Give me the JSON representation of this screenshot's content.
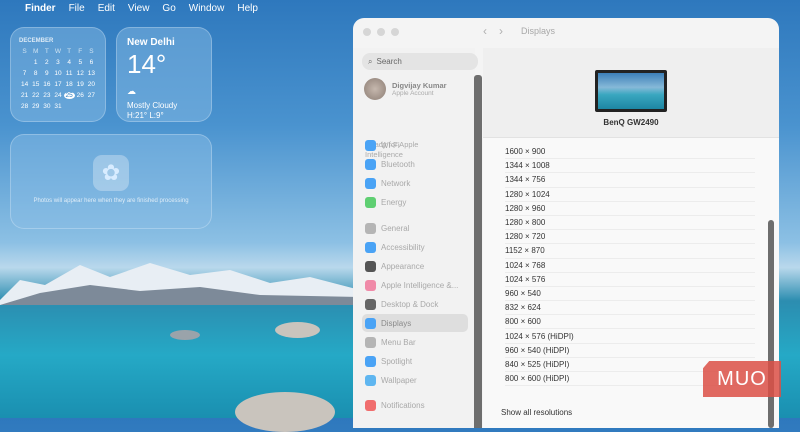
{
  "menubar": {
    "items": [
      "Finder",
      "File",
      "Edit",
      "View",
      "Go",
      "Window",
      "Help"
    ]
  },
  "calendar": {
    "month": "DECEMBER",
    "days_of_week": [
      "S",
      "M",
      "T",
      "W",
      "T",
      "F",
      "S"
    ],
    "days": [
      "",
      "1",
      "2",
      "3",
      "4",
      "5",
      "6",
      "7",
      "8",
      "9",
      "10",
      "11",
      "12",
      "13",
      "14",
      "15",
      "16",
      "17",
      "18",
      "19",
      "20",
      "21",
      "22",
      "23",
      "24",
      "25",
      "26",
      "27",
      "28",
      "29",
      "30",
      "31",
      "",
      "",
      ""
    ],
    "today": "25"
  },
  "weather": {
    "city": "New Delhi",
    "temp": "14°",
    "condition": "Mostly Cloudy",
    "hilo": "H:21° L:9°"
  },
  "photos": {
    "message": "Photos will appear here when they are finished processing"
  },
  "window": {
    "title": "Displays",
    "search_placeholder": "Search",
    "account": {
      "name": "Digvijay Kumar",
      "sub": "Apple Account"
    },
    "ready": "Ready for Apple Intelligence",
    "sidebar": [
      {
        "label": "Wi-Fi",
        "icon": "wifi-icon",
        "color": "#4aa3f5"
      },
      {
        "label": "Bluetooth",
        "icon": "bluetooth-icon",
        "color": "#4aa3f5"
      },
      {
        "label": "Network",
        "icon": "globe-icon",
        "color": "#4aa3f5"
      },
      {
        "label": "Energy",
        "icon": "battery-icon",
        "color": "#5fcf72"
      },
      {
        "label": "General",
        "icon": "gear-icon",
        "color": "#b5b5b5"
      },
      {
        "label": "Accessibility",
        "icon": "accessibility-icon",
        "color": "#4aa3f5"
      },
      {
        "label": "Appearance",
        "icon": "appearance-icon",
        "color": "#555555"
      },
      {
        "label": "Apple Intelligence &...",
        "icon": "apple-intelligence-icon",
        "color": "#f08aa8"
      },
      {
        "label": "Desktop & Dock",
        "icon": "dock-icon",
        "color": "#666666"
      },
      {
        "label": "Displays",
        "icon": "sun-icon",
        "color": "#4aa3f5"
      },
      {
        "label": "Menu Bar",
        "icon": "menubar-icon",
        "color": "#b5b5b5"
      },
      {
        "label": "Spotlight",
        "icon": "spotlight-icon",
        "color": "#4aa3f5"
      },
      {
        "label": "Wallpaper",
        "icon": "wallpaper-icon",
        "color": "#5fb6f0"
      },
      {
        "label": "Notifications",
        "icon": "bell-icon",
        "color": "#f06d6d"
      }
    ],
    "display_name": "BenQ GW2490",
    "resolutions": [
      "1600 × 900",
      "1344 × 1008",
      "1344 × 756",
      "1280 × 1024",
      "1280 × 960",
      "1280 × 800",
      "1280 × 720",
      "1152 × 870",
      "1024 × 768",
      "1024 × 576",
      "960 × 540",
      "832 × 624",
      "800 × 600",
      "1024 × 576 (HiDPI)",
      "960 × 540 (HiDPI)",
      "840 × 525 (HiDPI)",
      "800 × 600 (HiDPI)"
    ],
    "show_all": "Show all resolutions"
  },
  "watermark": "MUO"
}
